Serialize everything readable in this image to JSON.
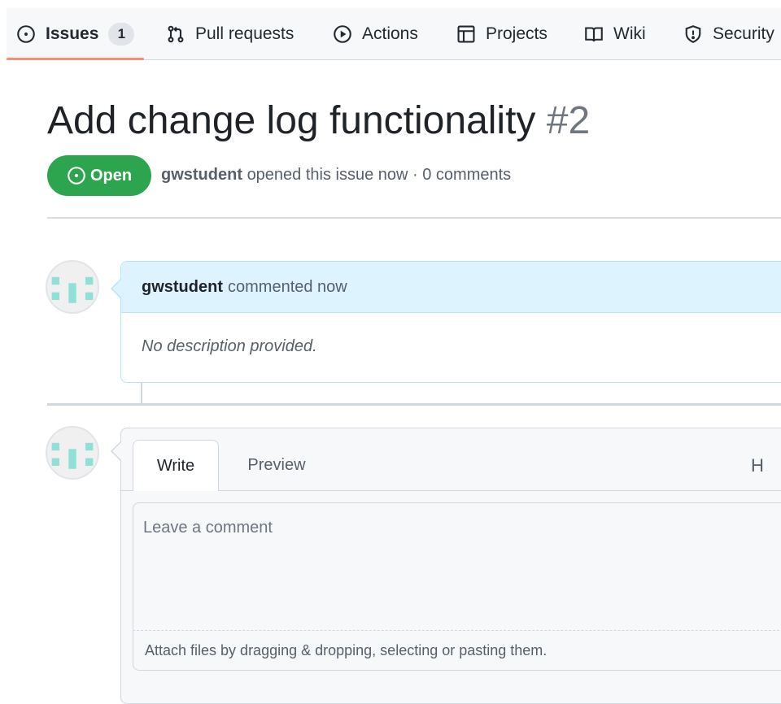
{
  "nav": {
    "tabs": [
      {
        "label": "Issues",
        "icon": "issue-opened-icon",
        "counter": "1",
        "selected": true
      },
      {
        "label": "Pull requests",
        "icon": "git-pull-request-icon"
      },
      {
        "label": "Actions",
        "icon": "play-icon"
      },
      {
        "label": "Projects",
        "icon": "table-icon"
      },
      {
        "label": "Wiki",
        "icon": "book-icon"
      },
      {
        "label": "Security",
        "icon": "shield-icon"
      }
    ]
  },
  "issue": {
    "title": "Add change log functionality",
    "number": "#2",
    "state": "Open",
    "author": "gwstudent",
    "meta_text": "opened this issue now · 0 comments"
  },
  "comment": {
    "author": "gwstudent",
    "action": "commented now",
    "body": "No description provided."
  },
  "form": {
    "write_tab": "Write",
    "preview_tab": "Preview",
    "heading_tool": "H",
    "placeholder": "Leave a comment",
    "attach_text": "Attach files by dragging & dropping, selecting or pasting them."
  },
  "colors": {
    "open_green": "#2da44e",
    "selected_underline": "#fd8c73",
    "comment_header_bg": "#ddf4ff",
    "comment_border": "#b6e3ff",
    "avatar_teal": "#8fe0d6"
  }
}
